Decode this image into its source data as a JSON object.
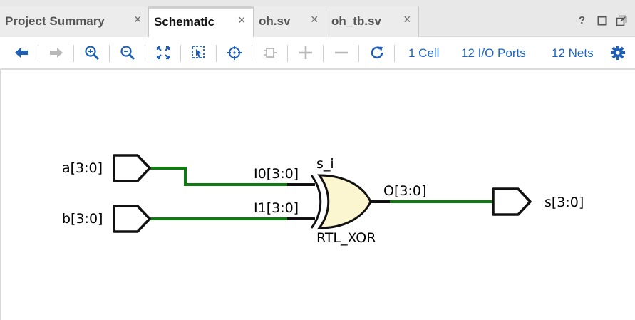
{
  "tabs": [
    {
      "label": "Project Summary",
      "active": false
    },
    {
      "label": "Schematic",
      "active": true
    },
    {
      "label": "oh.sv",
      "active": false
    },
    {
      "label": "oh_tb.sv",
      "active": false
    }
  ],
  "tab_close_glyph": "×",
  "window_controls": {
    "help": "?",
    "restore": "☐",
    "maximize": "⧉"
  },
  "toolbar": {
    "buttons": [
      {
        "icon": "arrow-left-icon",
        "enabled": true
      },
      {
        "icon": "arrow-right-icon",
        "enabled": false
      },
      {
        "icon": "zoom-in-icon",
        "enabled": true
      },
      {
        "icon": "zoom-out-icon",
        "enabled": true
      },
      {
        "icon": "zoom-fit-icon",
        "enabled": true
      },
      {
        "icon": "zoom-area-icon",
        "enabled": true
      },
      {
        "icon": "crosshair-icon",
        "enabled": true
      },
      {
        "icon": "cell-icon",
        "enabled": false
      },
      {
        "icon": "plus-icon",
        "enabled": false
      },
      {
        "icon": "minus-icon",
        "enabled": false
      },
      {
        "icon": "refresh-icon",
        "enabled": true
      }
    ],
    "cells_link": "1 Cell",
    "ports_link": "12 I/O Ports",
    "nets_link": "12 Nets",
    "settings_icon": "gear-icon"
  },
  "colors": {
    "accent_link": "#1a63c9",
    "icon_active": "#1f5fb5",
    "icon_disabled": "#b8b8b8",
    "wire": "#0f7a0f",
    "gate_fill": "#fbf6cf"
  },
  "schematic": {
    "inputs": [
      {
        "name": "a[3:0]"
      },
      {
        "name": "b[3:0]"
      }
    ],
    "outputs": [
      {
        "name": "s[3:0]"
      }
    ],
    "cell": {
      "instance": "s_i",
      "type": "RTL_XOR",
      "pins_in": [
        "I0[3:0]",
        "I1[3:0]"
      ],
      "pin_out": "O[3:0]"
    }
  }
}
